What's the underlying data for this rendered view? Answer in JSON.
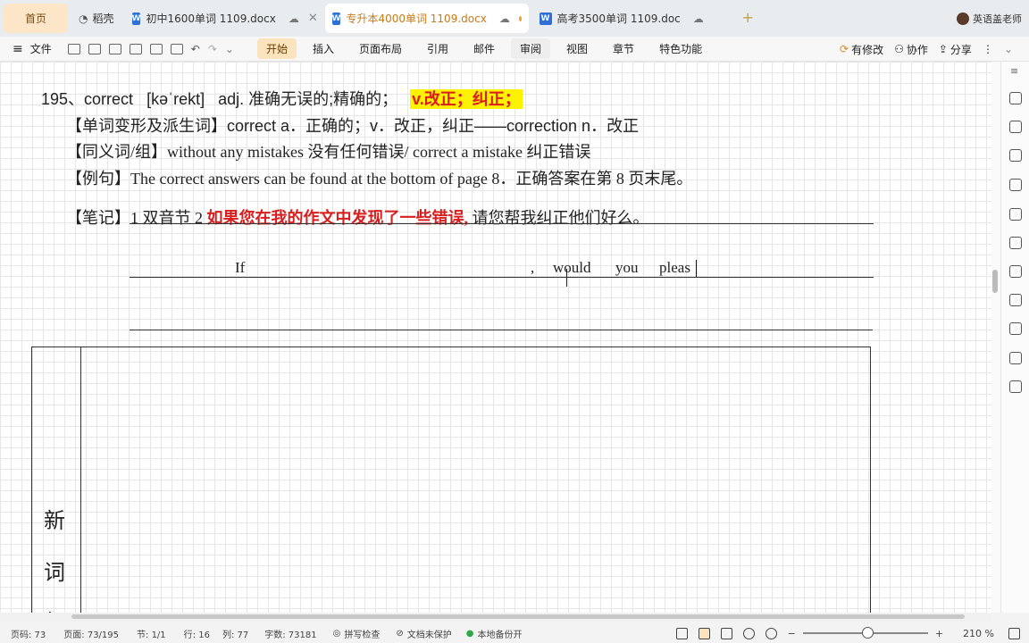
{
  "tabs": {
    "home": "首页",
    "shell": "稻壳",
    "doc1": "初中1600单词 1109.docx",
    "doc2": "专升本4000单词 1109.docx",
    "doc3": "高考3500单词 1109.doc",
    "user": "英语盖老师"
  },
  "menu": {
    "file": "文件",
    "items": [
      "开始",
      "插入",
      "页面布局",
      "引用",
      "邮件",
      "审阅",
      "视图",
      "章节",
      "特色功能"
    ],
    "modified": "有修改",
    "collab": "协作",
    "share": "分享"
  },
  "doc": {
    "entry": {
      "number_word": "195、correct",
      "phonetic": "[kəˈrekt]",
      "pos_def": "adj.  准确无误的;精确的；",
      "highlight": "v.改正；纠正；"
    },
    "derivation": {
      "label": "【单词变形及派生词】",
      "text": "correct a．正确的；v．改正，纠正——correction n．改正"
    },
    "synonym": {
      "label": "【同义词/组】",
      "text": "without any mistakes 没有任何错误/ correct a mistake 纠正错误"
    },
    "example": {
      "label": "【例句】",
      "text": "The correct answers can be found at the bottom of page 8．正确答案在第 8 页末尾。"
    },
    "note": {
      "label": "【笔记】",
      "prefix": "1  双音节  2  ",
      "red": "如果您在我的作文中发现了一些错误,",
      "rest": " 请您帮我纠正他们好么。"
    },
    "writing": {
      "if": "If",
      "comma": ",",
      "would": "would",
      "you": "you",
      "pleas": "pleas"
    },
    "side_chars": [
      "新",
      "词",
      "复"
    ]
  },
  "status": {
    "page_no": "页码: 73",
    "pages": "页面: 73/195",
    "section": "节: 1/1",
    "row": "行: 16",
    "col": "列: 77",
    "words": "字数: 73181",
    "spell": "拼写检查",
    "protect": "文档未保护",
    "backup": "本地备份开",
    "zoom": "210 %"
  }
}
